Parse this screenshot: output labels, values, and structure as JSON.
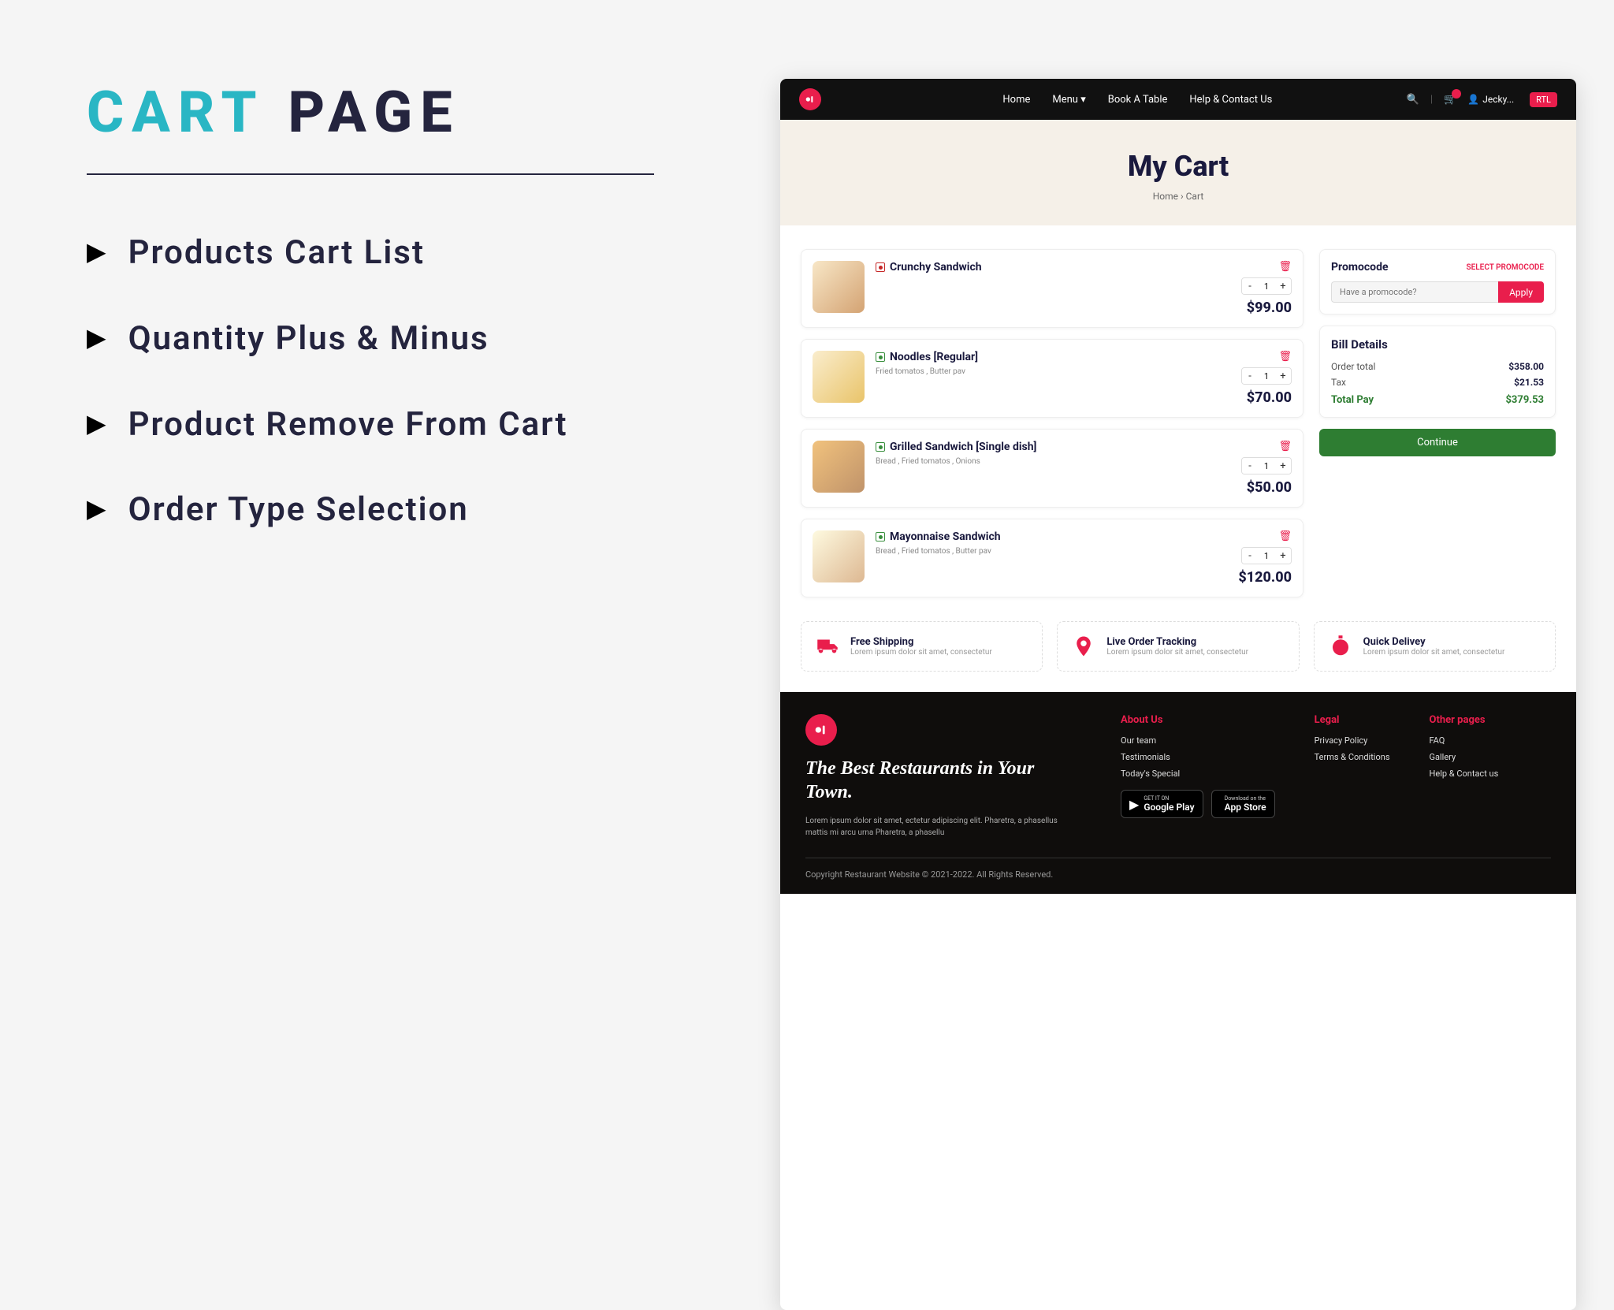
{
  "slide": {
    "title_part1": "CART",
    "title_part2": "PAGE",
    "features": [
      "Products Cart List",
      "Quantity Plus & Minus",
      "Product Remove From Cart",
      "Order Type Selection"
    ]
  },
  "nav": {
    "links": [
      "Home",
      "Menu",
      "Book A Table",
      "Help & Contact Us"
    ],
    "user": "Jecky...",
    "rtl": "RTL"
  },
  "hero": {
    "title": "My Cart",
    "breadcrumb": [
      "Home",
      "Cart"
    ]
  },
  "cart_items": [
    {
      "name": "Crunchy Sandwich",
      "sub": "",
      "qty": 1,
      "price": "$99.00",
      "veg": false
    },
    {
      "name": "Noodles [Regular]",
      "sub": "Fried tomatos , Butter pav",
      "qty": 1,
      "price": "$70.00",
      "veg": true
    },
    {
      "name": "Grilled Sandwich [Single dish]",
      "sub": "Bread , Fried tomatos , Onions",
      "qty": 1,
      "price": "$50.00",
      "veg": true
    },
    {
      "name": "Mayonnaise Sandwich",
      "sub": "Bread , Fried tomatos , Butter pav",
      "qty": 1,
      "price": "$120.00",
      "veg": true
    }
  ],
  "promo": {
    "title": "Promocode",
    "select": "SELECT PROMOCODE",
    "placeholder": "Have a promocode?",
    "apply": "Apply"
  },
  "bill": {
    "title": "Bill Details",
    "rows": [
      {
        "label": "Order total",
        "value": "$358.00"
      },
      {
        "label": "Tax",
        "value": "$21.53"
      }
    ],
    "total_label": "Total Pay",
    "total_value": "$379.53",
    "continue": "Continue"
  },
  "info_strip": [
    {
      "title": "Free Shipping",
      "sub": "Lorem ipsum dolor sit amet, consectetur"
    },
    {
      "title": "Live Order Tracking",
      "sub": "Lorem ipsum dolor sit amet, consectetur"
    },
    {
      "title": "Quick Delivey",
      "sub": "Lorem ipsum dolor sit amet, consectetur"
    }
  ],
  "footer": {
    "tagline": "The Best Restaurants in Your Town.",
    "desc": "Lorem ipsum dolor sit amet, ectetur adipiscing elit. Pharetra, a phasellus mattis mi arcu urna Pharetra, a phasellu",
    "cols": [
      {
        "title": "About Us",
        "links": [
          "Our team",
          "Testimonials",
          "Today's Special"
        ]
      },
      {
        "title": "Legal",
        "links": [
          "Privacy Policy",
          "Terms & Conditions"
        ]
      },
      {
        "title": "Other pages",
        "links": [
          "FAQ",
          "Gallery",
          "Help & Contact us"
        ]
      }
    ],
    "google_top": "GET IT ON",
    "google_bottom": "Google Play",
    "apple_top": "Download on the",
    "apple_bottom": "App Store",
    "copyright": "Copyright Restaurant Website © 2021-2022. All Rights Reserved."
  }
}
